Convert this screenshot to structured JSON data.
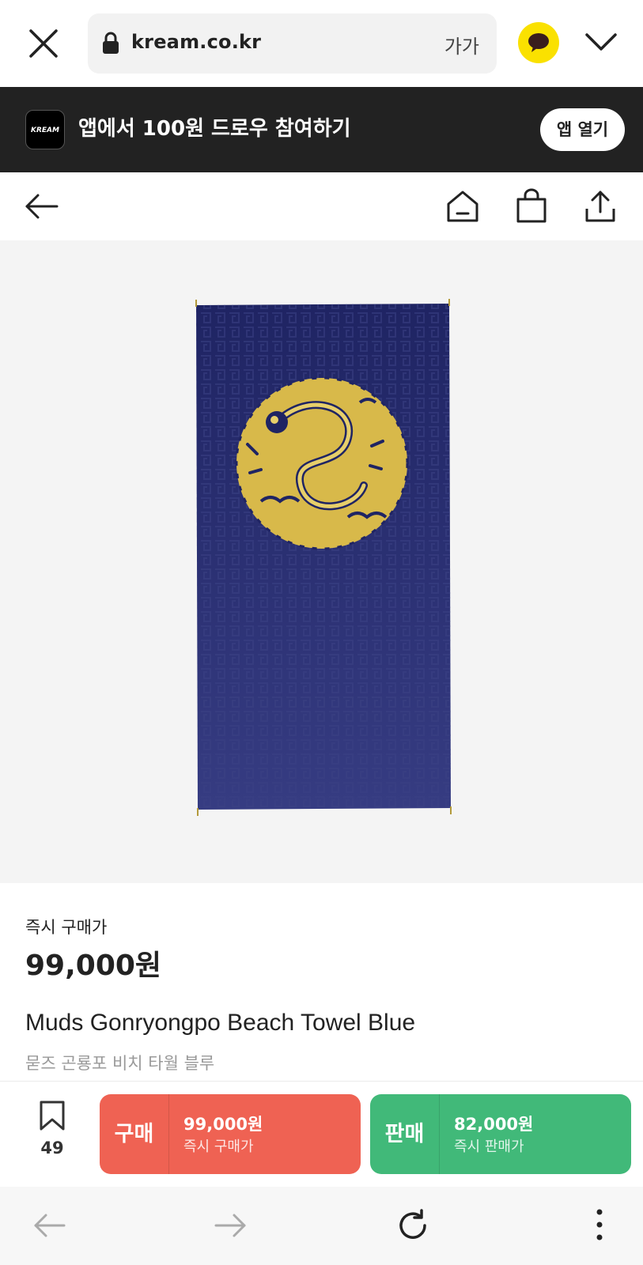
{
  "browser": {
    "url": "kream.co.kr",
    "text_size_label": "가가",
    "icons": [
      "close-icon",
      "lock-icon",
      "kakao-talk-icon",
      "chevron-down-icon"
    ]
  },
  "app_banner": {
    "logo_text": "KREAM",
    "text": "앱에서 100원 드로우 참여하기",
    "open_button": "앱 열기"
  },
  "page_nav": {
    "icons": [
      "back-arrow-icon",
      "home-icon",
      "shopping-bag-icon",
      "share-icon"
    ]
  },
  "product": {
    "price_label": "즉시 구매가",
    "price": "99,000원",
    "name": "Muds Gonryongpo Beach Towel Blue",
    "name_ko": "묻즈 곤룡포 비치 타월 블루"
  },
  "action_bar": {
    "wish_count": "49",
    "buy": {
      "title": "구매",
      "price": "99,000원",
      "sub": "즉시 구매가"
    },
    "sell": {
      "title": "판매",
      "price": "82,000원",
      "sub": "즉시 판매가"
    }
  },
  "colors": {
    "buy": "#ef6253",
    "sell": "#41b979",
    "banner": "#222222",
    "kakao": "#fae100",
    "towel": "#2a2f6e",
    "emblem": "#d8b94a"
  }
}
